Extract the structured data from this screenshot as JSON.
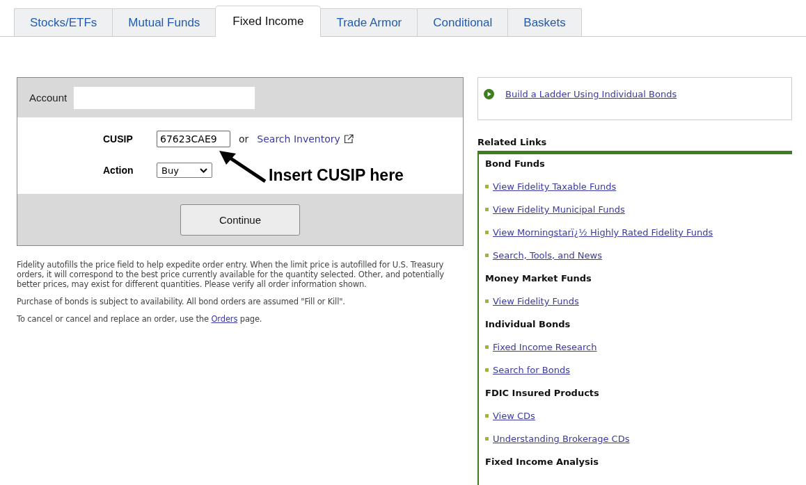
{
  "tabs": [
    {
      "label": "Stocks/ETFs",
      "selected": false
    },
    {
      "label": "Mutual Funds",
      "selected": false
    },
    {
      "label": "Fixed Income",
      "selected": true
    },
    {
      "label": "Trade Armor",
      "selected": false
    },
    {
      "label": "Conditional",
      "selected": false
    },
    {
      "label": "Baskets",
      "selected": false
    }
  ],
  "order_form": {
    "account_label": "Account",
    "cusip_label": "CUSIP",
    "cusip_value": "67623CAE9",
    "or_text": "or",
    "search_link": "Search Inventory",
    "action_label": "Action",
    "action_value": "Buy",
    "annotation": "Insert CUSIP here",
    "continue_button": "Continue"
  },
  "notes": [
    {
      "text": "Fidelity autofills the price field to help expedite order entry. When the limit price is autofilled for U.S. Treasury orders, it will correspond to the best price currently available for the quantity selected. Other, and potentially better prices, may exist for different quantities. Please verify all order information shown."
    },
    {
      "text": "Purchase of bonds is subject to availability. All bond orders are assumed \"Fill or Kill\"."
    },
    {
      "text": "To cancel or cancel and replace an order, use the",
      "link": "Orders",
      "after": "page."
    }
  ],
  "ladder_link": "Build a Ladder Using Individual Bonds",
  "related_links": {
    "title": "Related Links",
    "groups": [
      {
        "heading": "Bond Funds",
        "links": [
          "View Fidelity Taxable Funds",
          "View Fidelity Municipal Funds",
          "View Morningstarï¿½ Highly Rated Fidelity Funds",
          "Search, Tools, and News"
        ]
      },
      {
        "heading": "Money Market Funds",
        "links": [
          "View Fidelity Funds"
        ]
      },
      {
        "heading": "Individual Bonds",
        "links": [
          "Fixed Income Research",
          "Search for Bonds"
        ]
      },
      {
        "heading": "FDIC Insured Products",
        "links": [
          "View CDs",
          "Understanding Brokerage CDs"
        ]
      },
      {
        "heading": "Fixed Income Analysis"
      }
    ]
  }
}
